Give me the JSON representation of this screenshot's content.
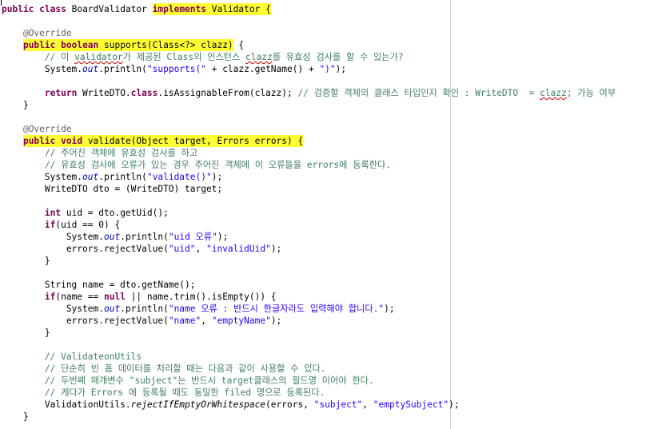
{
  "editor": {
    "lines": [
      [
        {
          "t": "public",
          "c": "kw"
        },
        {
          "t": " "
        },
        {
          "t": "class",
          "c": "kw"
        },
        {
          "t": " BoardValidator "
        },
        {
          "t": "implements",
          "c": "kw"
        },
        {
          "t": " Validator {"
        }
      ],
      [
        {
          "t": ""
        }
      ],
      [
        {
          "t": "    "
        },
        {
          "t": "@Override",
          "c": "ann"
        }
      ],
      [
        {
          "t": "    "
        },
        {
          "t": "public",
          "c": "kw"
        },
        {
          "t": " "
        },
        {
          "t": "boolean",
          "c": "kw"
        },
        {
          "t": " supports(Class<?> clazz) {"
        }
      ],
      [
        {
          "t": "        "
        },
        {
          "t": "// 이 ",
          "c": "cmt"
        },
        {
          "t": "validator",
          "c": "cmt squig"
        },
        {
          "t": "가 제공된 Class의 인스턴스 ",
          "c": "cmt"
        },
        {
          "t": "clazz",
          "c": "cmt squig"
        },
        {
          "t": "를 유효성 검사를 할 수 있는가?",
          "c": "cmt"
        }
      ],
      [
        {
          "t": "        System."
        },
        {
          "t": "out",
          "c": "sfld"
        },
        {
          "t": ".println("
        },
        {
          "t": "\"supports(\"",
          "c": "str"
        },
        {
          "t": " + clazz.getName() + "
        },
        {
          "t": "\")\"",
          "c": "str"
        },
        {
          "t": ");"
        }
      ],
      [
        {
          "t": ""
        }
      ],
      [
        {
          "t": "        "
        },
        {
          "t": "return",
          "c": "kw"
        },
        {
          "t": " WriteDTO."
        },
        {
          "t": "class",
          "c": "kw"
        },
        {
          "t": ".isAssignableFrom(clazz); "
        },
        {
          "t": "// 검증할 객체의 클래스 타입인지 확인 : WriteDTO  = ",
          "c": "cmt"
        },
        {
          "t": "clazz",
          "c": "cmt squig"
        },
        {
          "t": "; 가능 여부",
          "c": "cmt"
        }
      ],
      [
        {
          "t": "    }"
        }
      ],
      [
        {
          "t": ""
        }
      ],
      [
        {
          "t": "    "
        },
        {
          "t": "@Override",
          "c": "ann"
        }
      ],
      [
        {
          "t": "    "
        },
        {
          "t": "public",
          "c": "kw"
        },
        {
          "t": " "
        },
        {
          "t": "void",
          "c": "kw"
        },
        {
          "t": " validate(Object target, Errors errors) {"
        }
      ],
      [
        {
          "t": "        "
        },
        {
          "t": "// 주어진 객체에 유효성 검사를 하고",
          "c": "cmt"
        }
      ],
      [
        {
          "t": "        "
        },
        {
          "t": "// 유효성 검사에 오류가 있는 경우 주어진 객체에 이 오류들을 errors에 등록한다.",
          "c": "cmt"
        }
      ],
      [
        {
          "t": "        System."
        },
        {
          "t": "out",
          "c": "sfld"
        },
        {
          "t": ".println("
        },
        {
          "t": "\"validate()\"",
          "c": "str"
        },
        {
          "t": ");"
        }
      ],
      [
        {
          "t": "        WriteDTO dto = (WriteDTO) target;"
        }
      ],
      [
        {
          "t": ""
        }
      ],
      [
        {
          "t": "        "
        },
        {
          "t": "int",
          "c": "kw"
        },
        {
          "t": " uid = dto.getUid();"
        }
      ],
      [
        {
          "t": "        "
        },
        {
          "t": "if",
          "c": "kw"
        },
        {
          "t": "(uid == 0) {"
        }
      ],
      [
        {
          "t": "            System."
        },
        {
          "t": "out",
          "c": "sfld"
        },
        {
          "t": ".println("
        },
        {
          "t": "\"uid 오류\"",
          "c": "str"
        },
        {
          "t": ");"
        }
      ],
      [
        {
          "t": "            errors.rejectValue("
        },
        {
          "t": "\"uid\"",
          "c": "str"
        },
        {
          "t": ", "
        },
        {
          "t": "\"invalidUid\"",
          "c": "str"
        },
        {
          "t": ");"
        }
      ],
      [
        {
          "t": "        }"
        }
      ],
      [
        {
          "t": ""
        }
      ],
      [
        {
          "t": "        String name = dto.getName();"
        }
      ],
      [
        {
          "t": "        "
        },
        {
          "t": "if",
          "c": "kw"
        },
        {
          "t": "(name == "
        },
        {
          "t": "null",
          "c": "kw"
        },
        {
          "t": " || name.trim().isEmpty()) {"
        }
      ],
      [
        {
          "t": "            System."
        },
        {
          "t": "out",
          "c": "sfld"
        },
        {
          "t": ".println("
        },
        {
          "t": "\"name 오류 : 반드시 한글자라도 입력해야 합니다.\"",
          "c": "str"
        },
        {
          "t": ");"
        }
      ],
      [
        {
          "t": "            errors.rejectValue("
        },
        {
          "t": "\"name\"",
          "c": "str"
        },
        {
          "t": ", "
        },
        {
          "t": "\"emptyName\"",
          "c": "str"
        },
        {
          "t": ");"
        }
      ],
      [
        {
          "t": "        }"
        }
      ],
      [
        {
          "t": ""
        }
      ],
      [
        {
          "t": "        "
        },
        {
          "t": "// ValidateonUtils",
          "c": "cmt"
        }
      ],
      [
        {
          "t": "        "
        },
        {
          "t": "// 단순히 빈 폼 데이터를 처리할 때는 다음과 같이 사용할 수 있다.",
          "c": "cmt"
        }
      ],
      [
        {
          "t": "        "
        },
        {
          "t": "// 두번째 매개변수 \"subject\"는 반드시 target클래스의 필드명 이어야 한다.",
          "c": "cmt"
        }
      ],
      [
        {
          "t": "        "
        },
        {
          "t": "// 게다가 Errors 에 등록될 때도 동일한 filed 명으로 등록된다.",
          "c": "cmt"
        }
      ],
      [
        {
          "t": "        ValidationUtils."
        },
        {
          "t": "rejectIfEmptyOrWhitespace",
          "c": "smeth"
        },
        {
          "t": "(errors, "
        },
        {
          "t": "\"subject\"",
          "c": "str"
        },
        {
          "t": ", "
        },
        {
          "t": "\"emptySubject\"",
          "c": "str"
        },
        {
          "t": ");"
        }
      ],
      [
        {
          "t": "    }"
        }
      ]
    ],
    "highlights": [
      {
        "line": 0,
        "from": "implements Validator {"
      },
      {
        "line": 3,
        "from": "public boolean supports(Class<?> clazz)"
      },
      {
        "line": 11,
        "from": "public void validate(Object target, Errors errors) {"
      }
    ],
    "colors": {
      "keyword": "#7f0055",
      "string": "#2a00ff",
      "comment": "#3f7f5f",
      "annotation": "#646464",
      "static_field": "#0000c0",
      "highlight": "#ffff33",
      "print_margin": "#d0d0d0"
    }
  }
}
